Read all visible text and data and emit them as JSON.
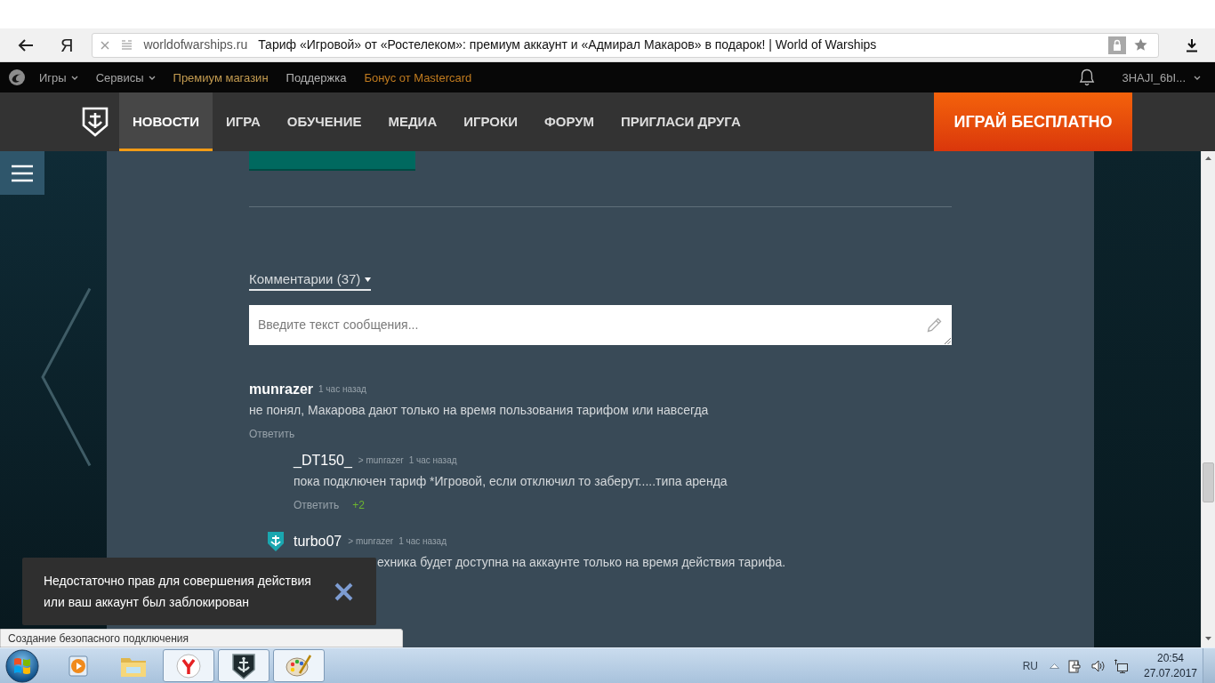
{
  "browser": {
    "menu_glyph": "Я",
    "address": {
      "domain": "worldofwarships.ru",
      "title": "Тариф «Игровой» от «Ростелеком»: премиум аккаунт и «Адмирал Макаров» в подарок! | World of Warships"
    }
  },
  "top_bar": {
    "links": [
      {
        "label": "Игры",
        "kind": "menu",
        "color": "#a6a6a6"
      },
      {
        "label": "Сервисы",
        "kind": "menu",
        "color": "#a6a6a6"
      },
      {
        "label": "Премиум магазин",
        "kind": "link",
        "color": "#c39b50"
      },
      {
        "label": "Поддержка",
        "kind": "link",
        "color": "#b4b4b4"
      },
      {
        "label": "Бонус от Mastercard",
        "kind": "link",
        "color": "#c07b1f"
      }
    ],
    "user": "3HAJI_6bI..."
  },
  "main_nav": {
    "tabs": [
      {
        "label": "НОВОСТИ",
        "selected": true
      },
      {
        "label": "ИГРА",
        "selected": false
      },
      {
        "label": "ОБУЧЕНИЕ",
        "selected": false
      },
      {
        "label": "МЕДИА",
        "selected": false
      },
      {
        "label": "ИГРОКИ",
        "selected": false
      },
      {
        "label": "ФОРУМ",
        "selected": false
      },
      {
        "label": "ПРИГЛАСИ ДРУГА",
        "selected": false
      }
    ],
    "play_button": "ИГРАЙ БЕСПЛАТНО"
  },
  "comments": {
    "heading": "Комментарии (37)",
    "input": {
      "placeholder": "Введите текст сообщения..."
    },
    "items": [
      {
        "author": "munrazer",
        "official": false,
        "time": "1 час назад",
        "text": "не понял, Макарова дают только на время пользования тарифом или навсегда",
        "reply_label": "Ответить",
        "children": [
          {
            "author": "_DT150_",
            "official": false,
            "reply_to": "> munrazer",
            "time": "1 час назад",
            "text": "пока подключен тариф *Игровой, если отключил то заберут.....типа аренда",
            "reply_label": "Ответить",
            "rating": "+2"
          },
          {
            "author": "turbo07",
            "official": true,
            "reply_to": "> munrazer",
            "time": "1 час назад",
            "text": "ехника будет доступна на аккаунте только на время действия тарифа."
          }
        ]
      }
    ]
  },
  "toast": {
    "text": "Недостаточно прав для совершения действия или ваш аккаунт был заблокирован"
  },
  "status_bubble": "Создание безопасного подключения",
  "taskbar": {
    "apps": [
      {
        "kind": "player",
        "running": false
      },
      {
        "kind": "folder",
        "running": false
      },
      {
        "kind": "browser",
        "running": true
      },
      {
        "kind": "game",
        "running": true
      },
      {
        "kind": "paint",
        "running": true
      }
    ],
    "tray": {
      "language": "RU",
      "time": "20:54",
      "date": "27.07.2017"
    }
  }
}
